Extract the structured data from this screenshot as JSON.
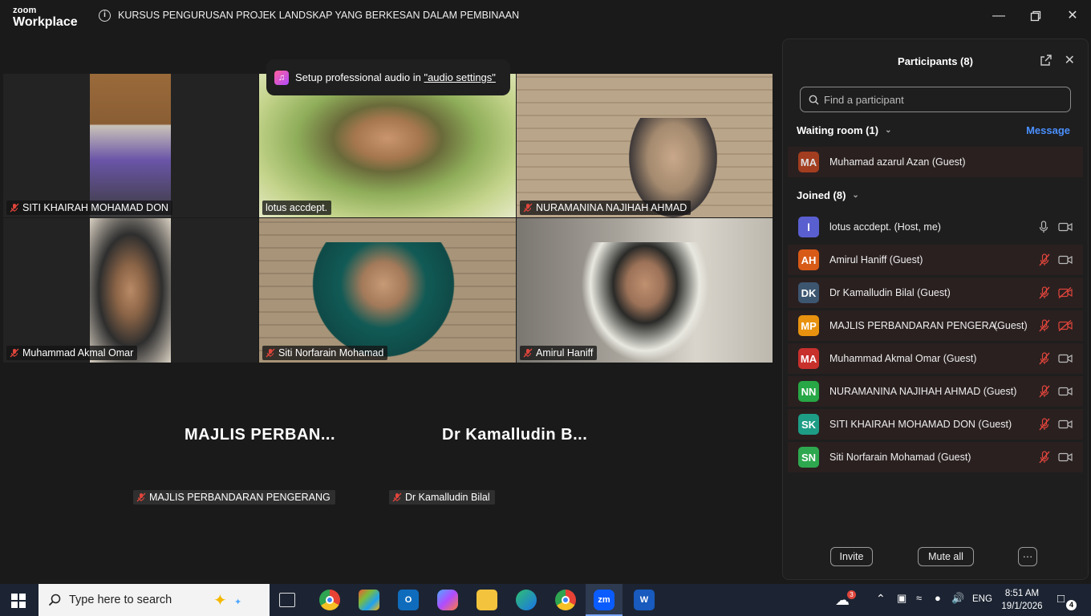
{
  "titlebar": {
    "logo_top": "zoom",
    "logo_bottom": "Workplace",
    "meeting_title": "KURSUS PENGURUSAN PROJEK LANDSKAP YANG BERKESAN DALAM PEMBINAAN"
  },
  "toast": {
    "text": "Setup professional audio in ",
    "link": "\"audio settings\""
  },
  "video_tiles": [
    {
      "name": "SITI KHAIRAH MOHAMAD DON",
      "muted": true
    },
    {
      "name": "lotus accdept.",
      "muted": false,
      "active": true
    },
    {
      "name": "NURAMANINA NAJIHAH AHMAD",
      "muted": true
    },
    {
      "name": "Muhammad Akmal Omar",
      "muted": true
    },
    {
      "name": "Siti Norfarain Mohamad",
      "muted": true
    },
    {
      "name": "Amirul Haniff",
      "muted": true
    }
  ],
  "no_video_tiles": [
    {
      "display": "MAJLIS  PERBAN...",
      "tag": "MAJLIS PERBANDARAN PENGERANG"
    },
    {
      "display": "Dr Kamalludin B...",
      "tag": "Dr Kamalludin Bilal"
    }
  ],
  "panel": {
    "title": "Participants (8)",
    "search_placeholder": "Find a participant",
    "waiting_header": "Waiting room (1)",
    "message_label": "Message",
    "joined_header": "Joined (8)",
    "waiting": [
      {
        "initials": "MA",
        "name": "Muhamad azarul Azan (Guest)",
        "color": "#b8431f"
      }
    ],
    "joined": [
      {
        "initials": "l",
        "name": "lotus accdept. (Host, me)",
        "guest": "",
        "color": "#5a5fd0",
        "mic": "on",
        "cam": "on"
      },
      {
        "initials": "AH",
        "name": "Amirul Haniff (Guest)",
        "guest": "",
        "color": "#d85a17",
        "mic": "off",
        "cam": "on"
      },
      {
        "initials": "DK",
        "name": "Dr Kamalludin Bilal (Guest)",
        "guest": "",
        "color": "#3d5670",
        "mic": "off",
        "cam": "off"
      },
      {
        "initials": "MP",
        "name": "MAJLIS PERBANDARAN PENGERA...",
        "guest": "(Guest)",
        "color": "#e8920f",
        "mic": "off",
        "cam": "off"
      },
      {
        "initials": "MA",
        "name": "Muhammad Akmal Omar (Guest)",
        "guest": "",
        "color": "#c8302c",
        "mic": "off",
        "cam": "on"
      },
      {
        "initials": "NN",
        "name": "NURAMANINA NAJIHAH AHMAD (Guest)",
        "guest": "",
        "color": "#27a745",
        "mic": "off",
        "cam": "on"
      },
      {
        "initials": "SK",
        "name": "SITI KHAIRAH MOHAMAD DON (Guest)",
        "guest": "",
        "color": "#1d9d86",
        "mic": "off",
        "cam": "on"
      },
      {
        "initials": "SN",
        "name": "Siti Norfarain Mohamad (Guest)",
        "guest": "",
        "color": "#2ea84f",
        "mic": "off",
        "cam": "on"
      }
    ],
    "invite_label": "Invite",
    "mute_all_label": "Mute all",
    "more_label": "···"
  },
  "taskbar": {
    "search_placeholder": "Type here to search",
    "language": "ENG",
    "time": "8:51 AM",
    "date": "19/1/2026",
    "weather_badge": "3",
    "notification_count": "4",
    "zoom_app": "zm"
  },
  "colors": {
    "accent_green": "#3fdc6a",
    "link_blue": "#4a90ff",
    "muted_red": "#e0453b"
  }
}
